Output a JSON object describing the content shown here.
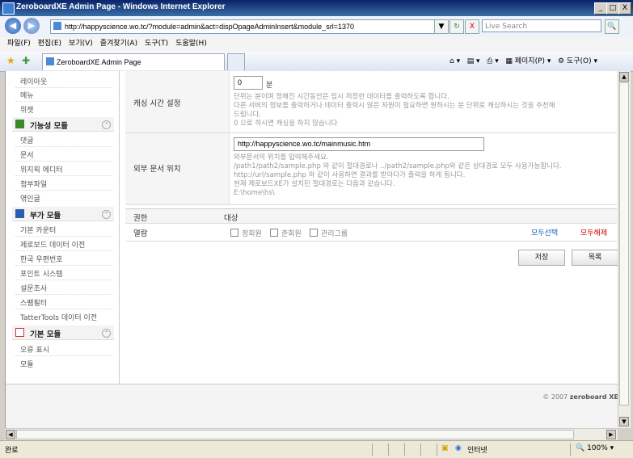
{
  "window": {
    "title": "ZeroboardXE Admin Page - Windows Internet Explorer",
    "min": "_",
    "max": "□",
    "close": "X"
  },
  "nav": {
    "back": "◀",
    "forward": "▶",
    "address": "http://happyscience.wo.tc/?module=admin&act=dispOpageAdminInsert&module_srl=1370",
    "dropdown": "▼",
    "refresh": "↻",
    "stop": "X",
    "search_placeholder": "Live Search",
    "search_btn": "🔍"
  },
  "menu": [
    "파일(F)",
    "편집(E)",
    "보기(V)",
    "즐겨찾기(A)",
    "도구(T)",
    "도움말(H)"
  ],
  "tab": {
    "title": "ZeroboardXE Admin Page"
  },
  "toolbar_right": {
    "page": "페이지(P)",
    "tools": "도구(O)"
  },
  "sidebar": {
    "items_top": [
      "레이아웃",
      "메뉴",
      "위젯"
    ],
    "group1": {
      "title": "기능성 모듈",
      "items": [
        "댓글",
        "문서",
        "위지윅 에디터",
        "첨부파일",
        "엮인글"
      ]
    },
    "group2": {
      "title": "부가 모듈",
      "items": [
        "기본 카운터",
        "제로보드 데이터 이전",
        "한국 우편번호",
        "포인트 시스템",
        "설문조사",
        "스팸필터",
        "TatterTools 데이터 이전"
      ]
    },
    "group3": {
      "title": "기본 모듈",
      "items": [
        "오류 표시",
        "모듈"
      ]
    }
  },
  "form": {
    "cache": {
      "label": "캐싱 시간 설정",
      "value": "0",
      "unit": "분",
      "desc1": "단위는 분이며 정해진 시간동안은 임시 저장한 데이터를 출력하도록 합니다.",
      "desc2": "다른 서버의 정보를 출력하거나 데이터 출력시 많은 자원이 필요하면 원하시는 분 단위로 캐싱하시는 것을 추천해",
      "desc3": "드립니다.",
      "desc4": "0 으로 하시면 캐싱을 하지 않습니다"
    },
    "ext": {
      "label": "외부 문서 위치",
      "value": "http://happyscience.wo.tc/mainmusic.htm",
      "desc1": "외부문서의 위치를 입력해주세요.",
      "desc2": "/path1/path2/sample.php 와 같이 절대경로나 ../path2/sample.php와 같은 상대경로 모두 사용가능합니다.",
      "desc3": "http://url/sample.php 와 같이 사용하면 결과를 받아다가 출력을 하게 됩니다.",
      "desc4": "현재 제로보드XE가 설치된 절대경로는 다음과 같습니다.",
      "path": "E:\\home\\hs\\"
    },
    "perm": {
      "header": "권한",
      "target": "대상",
      "row": "열람",
      "opts": [
        "정회원",
        "준회원",
        "관리그룹"
      ],
      "select_all": "모두선택",
      "deselect_all": "모두해제"
    },
    "save": "저장",
    "list": "목록"
  },
  "footer": {
    "copy": "© 2007",
    "brand": "zeroboard XE"
  },
  "status": {
    "done": "완료",
    "zone": "인터넷",
    "zoom": "100%"
  },
  "colors": {
    "select_all": "#1a5fb4",
    "deselect_all": "#cc0000",
    "titlebar": "#0a246a"
  }
}
